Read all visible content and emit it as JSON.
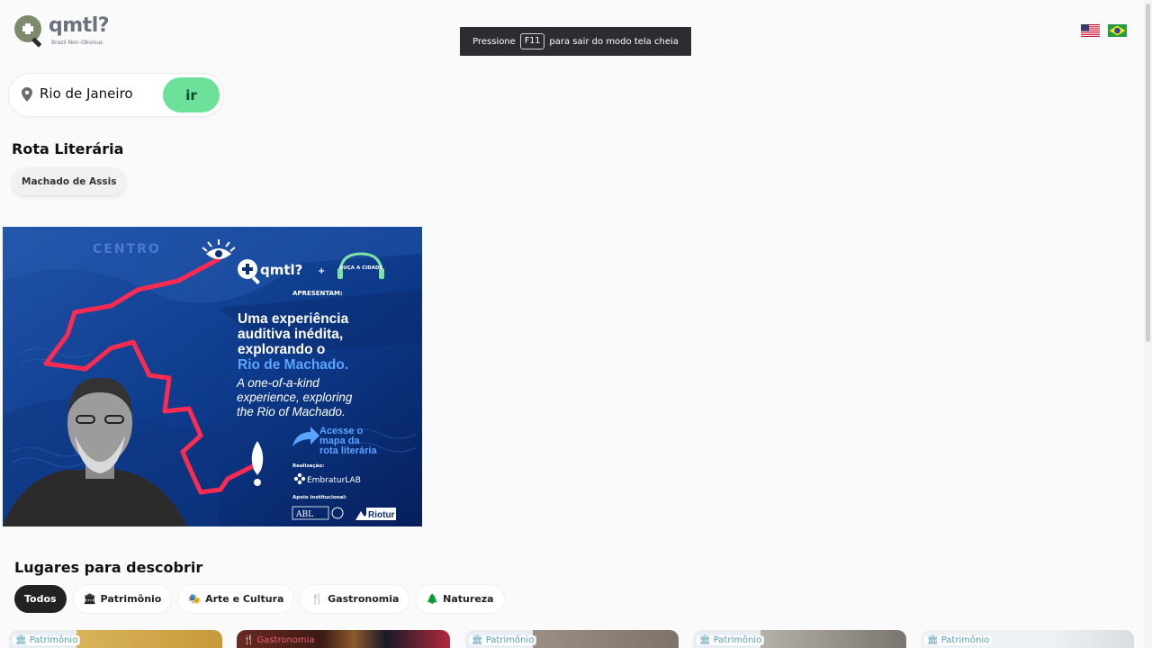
{
  "app": {
    "logo_text": "qmtl?",
    "logo_subtitle": "Brazil Non-Obvious"
  },
  "fullscreen_notice": {
    "prefix": "Pressione",
    "key": "F11",
    "suffix": "para sair do modo tela cheia"
  },
  "languages": [
    {
      "name": "English",
      "icon": "us-flag-icon"
    },
    {
      "name": "Português",
      "icon": "brazil-flag-icon"
    }
  ],
  "search": {
    "value": "Rio de Janeiro",
    "button_label": "ir"
  },
  "route": {
    "title": "Rota Literária",
    "chip_label": "Machado de Assis"
  },
  "banner": {
    "district_label": "CENTRO",
    "brand": "qmtl?",
    "plus": "+",
    "partner": "OUÇA A CIDADE",
    "presenting": "APRESENTAM:",
    "pt_line1": "Uma experiência",
    "pt_line2": "auditiva inédita,",
    "pt_line3": "explorando o",
    "pt_line4": "Rio de Machado.",
    "en_line1": "A one-of-a-kind",
    "en_line2": "experience, exploring",
    "en_line3": "the Rio of Machado.",
    "cta_line1": "Acesse o",
    "cta_line2": "mapa da",
    "cta_line3": "rota literária",
    "realizacao": "Realização:",
    "embratur": "EmbraturLAB",
    "apoio": "Apoio institucional:",
    "abl": "ABL",
    "riotur": "Riotur",
    "colors": {
      "background": "#0b2f78",
      "route_line": "#ff2a4f",
      "accent_text": "#5aa3ff"
    }
  },
  "discover": {
    "title": "Lugares para descobrir",
    "filters": [
      {
        "label": "Todos",
        "icon": "",
        "active": true
      },
      {
        "label": "Patrimônio",
        "icon": "museum-icon",
        "active": false
      },
      {
        "label": "Arte e Cultura",
        "icon": "palette-icon",
        "active": false
      },
      {
        "label": "Gastronomia",
        "icon": "utensils-icon",
        "active": false
      },
      {
        "label": "Natureza",
        "icon": "tree-icon",
        "active": false
      }
    ],
    "cards": [
      {
        "tag": "Patrimônio",
        "icon": "museum-icon"
      },
      {
        "tag": "Gastronomia",
        "icon": "utensils-icon"
      },
      {
        "tag": "Patrimônio",
        "icon": "museum-icon"
      },
      {
        "tag": "Patrimônio",
        "icon": "museum-icon"
      },
      {
        "tag": "Patrimônio",
        "icon": "museum-icon"
      }
    ]
  }
}
